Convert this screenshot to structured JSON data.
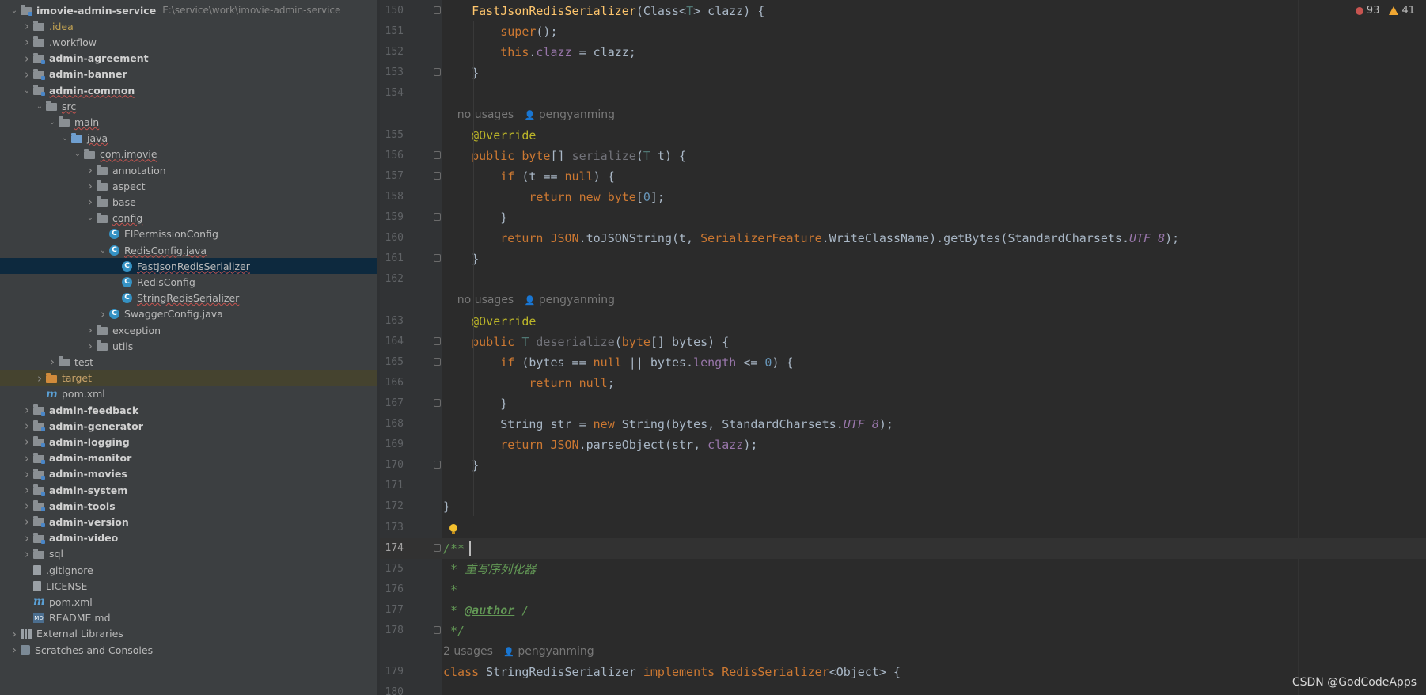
{
  "project_tree": [
    {
      "indent": 0,
      "arrow": "down",
      "icon": "folder-module",
      "label": "imovie-admin-service",
      "bold": true,
      "path": "E:\\service\\work\\imovie-admin-service"
    },
    {
      "indent": 1,
      "arrow": "right",
      "icon": "folder",
      "label": ".idea",
      "style": "idea"
    },
    {
      "indent": 1,
      "arrow": "right",
      "icon": "folder",
      "label": ".workflow"
    },
    {
      "indent": 1,
      "arrow": "right",
      "icon": "folder-module",
      "label": "admin-agreement",
      "bold": true
    },
    {
      "indent": 1,
      "arrow": "right",
      "icon": "folder-module",
      "label": "admin-banner",
      "bold": true
    },
    {
      "indent": 1,
      "arrow": "down",
      "icon": "folder-module",
      "label": "admin-common",
      "bold": true,
      "underline": true
    },
    {
      "indent": 2,
      "arrow": "down",
      "icon": "folder",
      "label": "src",
      "underline": true
    },
    {
      "indent": 3,
      "arrow": "down",
      "icon": "folder",
      "label": "main",
      "underline": true
    },
    {
      "indent": 4,
      "arrow": "down",
      "icon": "folder-src",
      "label": "java",
      "underline": true
    },
    {
      "indent": 5,
      "arrow": "down",
      "icon": "folder",
      "label": "com.imovie",
      "underline": true
    },
    {
      "indent": 6,
      "arrow": "right",
      "icon": "folder",
      "label": "annotation"
    },
    {
      "indent": 6,
      "arrow": "right",
      "icon": "folder",
      "label": "aspect"
    },
    {
      "indent": 6,
      "arrow": "right",
      "icon": "folder",
      "label": "base"
    },
    {
      "indent": 6,
      "arrow": "down",
      "icon": "folder",
      "label": "config",
      "underline": true
    },
    {
      "indent": 7,
      "arrow": "none",
      "icon": "class",
      "label": "ElPermissionConfig"
    },
    {
      "indent": 7,
      "arrow": "down",
      "icon": "class",
      "label": "RedisConfig.java",
      "underline": true
    },
    {
      "indent": 8,
      "arrow": "none",
      "icon": "class",
      "label": "FastJsonRedisSerializer",
      "selected": true,
      "underline": true
    },
    {
      "indent": 8,
      "arrow": "none",
      "icon": "class",
      "label": "RedisConfig"
    },
    {
      "indent": 8,
      "arrow": "none",
      "icon": "class",
      "label": "StringRedisSerializer",
      "underline": true
    },
    {
      "indent": 7,
      "arrow": "right",
      "icon": "class",
      "label": "SwaggerConfig.java"
    },
    {
      "indent": 6,
      "arrow": "right",
      "icon": "folder",
      "label": "exception"
    },
    {
      "indent": 6,
      "arrow": "right",
      "icon": "folder",
      "label": "utils"
    },
    {
      "indent": 3,
      "arrow": "right",
      "icon": "folder",
      "label": "test"
    },
    {
      "indent": 2,
      "arrow": "right",
      "icon": "folder-excluded",
      "label": "target",
      "excluded": true
    },
    {
      "indent": 2,
      "arrow": "none",
      "icon": "maven",
      "label": "pom.xml"
    },
    {
      "indent": 1,
      "arrow": "right",
      "icon": "folder-module",
      "label": "admin-feedback",
      "bold": true
    },
    {
      "indent": 1,
      "arrow": "right",
      "icon": "folder-module",
      "label": "admin-generator",
      "bold": true
    },
    {
      "indent": 1,
      "arrow": "right",
      "icon": "folder-module",
      "label": "admin-logging",
      "bold": true
    },
    {
      "indent": 1,
      "arrow": "right",
      "icon": "folder-module",
      "label": "admin-monitor",
      "bold": true
    },
    {
      "indent": 1,
      "arrow": "right",
      "icon": "folder-module",
      "label": "admin-movies",
      "bold": true
    },
    {
      "indent": 1,
      "arrow": "right",
      "icon": "folder-module",
      "label": "admin-system",
      "bold": true
    },
    {
      "indent": 1,
      "arrow": "right",
      "icon": "folder-module",
      "label": "admin-tools",
      "bold": true
    },
    {
      "indent": 1,
      "arrow": "right",
      "icon": "folder-module",
      "label": "admin-version",
      "bold": true
    },
    {
      "indent": 1,
      "arrow": "right",
      "icon": "folder-module",
      "label": "admin-video",
      "bold": true
    },
    {
      "indent": 1,
      "arrow": "right",
      "icon": "folder",
      "label": "sql"
    },
    {
      "indent": 1,
      "arrow": "none",
      "icon": "file",
      "label": ".gitignore"
    },
    {
      "indent": 1,
      "arrow": "none",
      "icon": "file",
      "label": "LICENSE"
    },
    {
      "indent": 1,
      "arrow": "none",
      "icon": "maven",
      "label": "pom.xml"
    },
    {
      "indent": 1,
      "arrow": "none",
      "icon": "markdown",
      "label": "README.md"
    },
    {
      "indent": 0,
      "arrow": "right",
      "icon": "libraries",
      "label": "External Libraries"
    },
    {
      "indent": 0,
      "arrow": "right",
      "icon": "scratches",
      "label": "Scratches and Consoles"
    }
  ],
  "inspections": {
    "errors": "93",
    "warnings": "41"
  },
  "code_lines": [
    {
      "num": "150",
      "fold": true,
      "html": "    <span class='fn'>FastJsonRedisSerializer</span>(Class&lt;<span class='typ'>T</span>&gt; clazz) {"
    },
    {
      "num": "151",
      "html": "        <span class='kw'>super</span>();"
    },
    {
      "num": "152",
      "html": "        <span class='kw'>this</span>.<span class='fld'>clazz</span> = clazz;"
    },
    {
      "num": "153",
      "fold": true,
      "html": "    }"
    },
    {
      "num": "154",
      "html": ""
    },
    {
      "hint": true,
      "html": "    no usages   <span style='font-size:11px'>&#128100;</span> pengyanming"
    },
    {
      "num": "155",
      "html": "    <span class='ann'>@Override</span>"
    },
    {
      "num": "156",
      "fold": true,
      "html": "    <span class='kw'>public</span> <span class='kw'>byte</span>[] <span class='unused'>serialize</span>(<span class='typ'>T</span> t) {"
    },
    {
      "num": "157",
      "fold": true,
      "html": "        <span class='kw'>if</span> (t == <span class='kw'>null</span>) {"
    },
    {
      "num": "158",
      "html": "            <span class='kw'>return new byte</span>[<span class='num'>0</span>];"
    },
    {
      "num": "159",
      "fold": true,
      "html": "        }"
    },
    {
      "num": "160",
      "html": "        <span class='kw'>return</span> <span class='jsn'>JSON</span>.toJSONString(t, <span class='jsn'>SerializerFeature</span>.WriteClassName).getBytes(StandardCharsets.<span class='st'>UTF_8</span>);"
    },
    {
      "num": "161",
      "fold": true,
      "html": "    }"
    },
    {
      "num": "162",
      "html": ""
    },
    {
      "hint": true,
      "html": "    no usages   <span style='font-size:11px'>&#128100;</span> pengyanming"
    },
    {
      "num": "163",
      "html": "    <span class='ann'>@Override</span>"
    },
    {
      "num": "164",
      "fold": true,
      "html": "    <span class='kw'>public</span> <span class='typ'>T</span> <span class='unused'>deserialize</span>(<span class='kw'>byte</span>[] bytes) {"
    },
    {
      "num": "165",
      "fold": true,
      "html": "        <span class='kw'>if</span> (bytes == <span class='kw'>null</span> || bytes.<span class='fld'>length</span> &lt;= <span class='num'>0</span>) {"
    },
    {
      "num": "166",
      "html": "            <span class='kw'>return null</span>;"
    },
    {
      "num": "167",
      "fold": true,
      "html": "        }"
    },
    {
      "num": "168",
      "html": "        String str = <span class='kw'>new</span> String(bytes, StandardCharsets.<span class='st'>UTF_8</span>);"
    },
    {
      "num": "169",
      "html": "        <span class='kw'>return</span> <span class='jsn'>JSON</span>.parseObject(str, <span class='fld'>clazz</span>);"
    },
    {
      "num": "170",
      "fold": true,
      "html": "    }"
    },
    {
      "num": "171",
      "html": ""
    },
    {
      "num": "172",
      "html": "}"
    },
    {
      "num": "173",
      "html": ""
    },
    {
      "num": "174",
      "fold": true,
      "current": true,
      "html": "<span class='cmt'>/**</span>"
    },
    {
      "num": "175",
      "html": "<span class='cmt'> * 重写序列化器</span>"
    },
    {
      "num": "176",
      "html": "<span class='cmt'> *</span>"
    },
    {
      "num": "177",
      "html": "<span class='cmt'> * </span><span class='tag'>@author</span><span class='cmt'> /</span>"
    },
    {
      "num": "178",
      "fold": true,
      "html": "<span class='cmt'> */</span>"
    },
    {
      "hint": true,
      "html": "2 usages   <span style='font-size:11px'>&#128100;</span> pengyanming"
    },
    {
      "num": "179",
      "html": "<span class='kw'>class</span> StringRedisSerializer <span class='kw'>implements</span> <span class='jsn'>RedisSerializer</span>&lt;Object&gt; {"
    },
    {
      "num": "180",
      "html": ""
    }
  ],
  "watermark": "CSDN @GodCodeApps"
}
